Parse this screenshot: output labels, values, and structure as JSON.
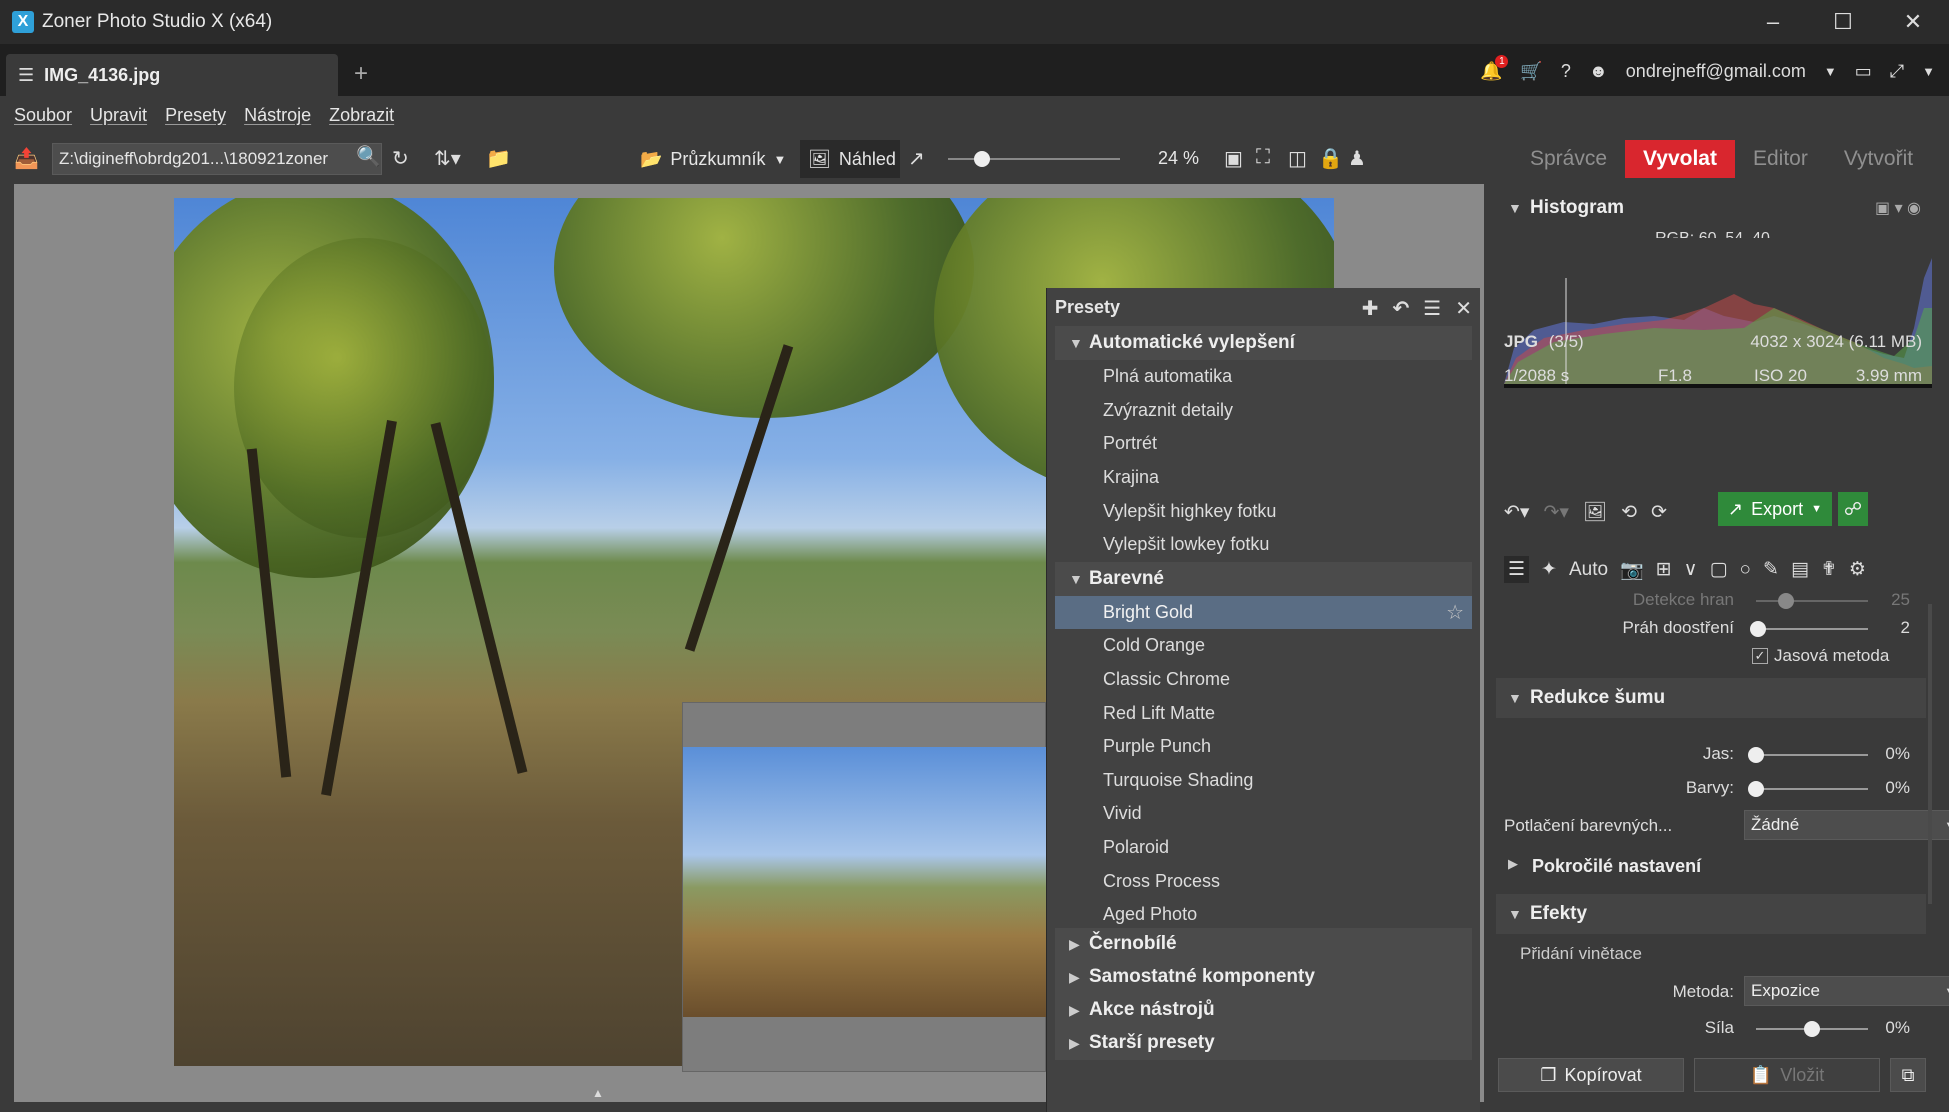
{
  "window": {
    "title": "Zoner Photo Studio X (x64)",
    "logo": "X"
  },
  "tabs": {
    "active_label": "IMG_4136.jpg",
    "add": "+"
  },
  "top_right": {
    "notifications_count": "1",
    "account": "ondrejneff@gmail.com"
  },
  "menu": [
    "Soubor",
    "Upravit",
    "Presety",
    "Nástroje",
    "Zobrazit"
  ],
  "toolbar": {
    "path": "Z:\\digineff\\obrdg201...\\180921zoner",
    "explorer_label": "Průzkumník",
    "preview_label": "Náhled",
    "zoom_value": "24 %",
    "zoom_fraction": 0.2
  },
  "modes": [
    {
      "label": "Správce",
      "active": false
    },
    {
      "label": "Vyvolat",
      "active": true
    },
    {
      "label": "Editor",
      "active": false
    },
    {
      "label": "Vytvořit",
      "active": false
    }
  ],
  "presets": {
    "title": "Presety",
    "groups": [
      {
        "label": "Automatické vylepšení",
        "expanded": true,
        "items": [
          "Plná automatika",
          "Zvýraznit detaily",
          "Portrét",
          "Krajina",
          "Vylepšit highkey fotku",
          "Vylepšit lowkey fotku"
        ]
      },
      {
        "label": "Barevné",
        "expanded": true,
        "items": [
          "Bright Gold",
          "Cold Orange",
          "Classic Chrome",
          "Red Lift Matte",
          "Purple Punch",
          "Turquoise Shading",
          "Vivid",
          "Polaroid",
          "Cross Process",
          "Aged Photo"
        ]
      },
      {
        "label": "Černobílé",
        "expanded": false,
        "items": []
      },
      {
        "label": "Samostatné komponenty",
        "expanded": false,
        "items": []
      },
      {
        "label": "Akce nástrojů",
        "expanded": false,
        "items": []
      },
      {
        "label": "Starší presety",
        "expanded": false,
        "items": []
      }
    ],
    "selected": "Bright Gold"
  },
  "histogram": {
    "title": "Histogram",
    "rgb": "RGB: 60, 54, 40"
  },
  "info": {
    "format": "JPG",
    "index": "(3/5)",
    "dimensions": "4032 x 3024 (6.11 MB)",
    "shutter": "1/2088 s",
    "aperture": "F1.8",
    "iso": "ISO 20",
    "focal": "3.99 mm"
  },
  "actions": {
    "export_label": "Export",
    "auto_label": "Auto"
  },
  "sharpen": {
    "edge_label": "Detekce hran",
    "edge_value": "25",
    "edge_fraction": 0.27,
    "threshold_label": "Práh doostření",
    "threshold_value": "2",
    "threshold_fraction": 0.02,
    "method_label": "Jasová metoda"
  },
  "noise": {
    "title": "Redukce šumu",
    "luma_label": "Jas:",
    "luma_value": "0%",
    "chroma_label": "Barvy:",
    "chroma_value": "0%",
    "suppress_label": "Potlačení barevných...",
    "suppress_value": "Žádné",
    "advanced_label": "Pokročilé nastavení"
  },
  "effects": {
    "title": "Efekty",
    "vignette_label": "Přidání vinětace",
    "method_label": "Metoda:",
    "method_value": "Expozice",
    "strength_label": "Síla",
    "strength_value": "0%",
    "strength_fraction": 0.5
  },
  "bottom": {
    "copy_label": "Kopírovat",
    "paste_label": "Vložit"
  }
}
